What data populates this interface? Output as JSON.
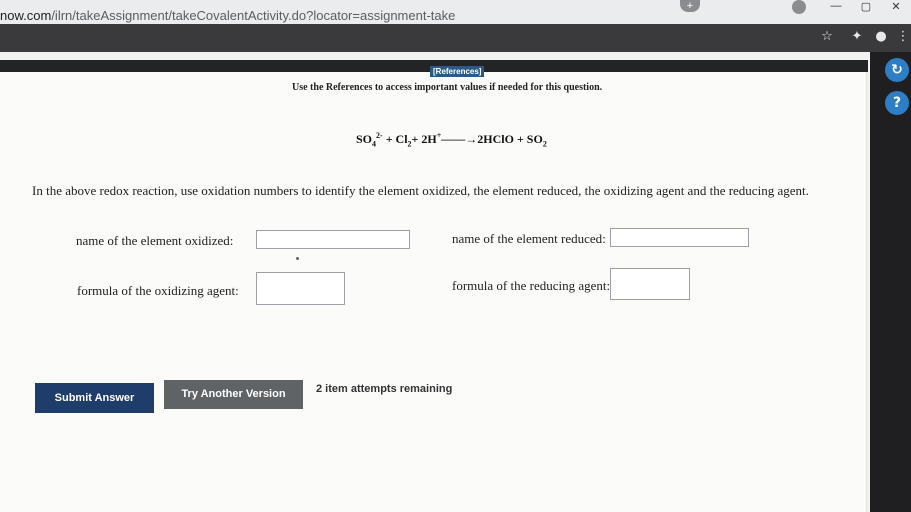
{
  "browser": {
    "url_domain": "now.com",
    "url_path": "/ilrn/takeAssignment/takeCovalentActivity.do?locator=assignment-take",
    "window_controls": [
      "—",
      "▢",
      "✕"
    ],
    "tab_plus": "+",
    "toolbar_icons": [
      "star-icon",
      "extension-icon",
      "profile-icon",
      "menu-icon"
    ]
  },
  "references_button": "[References]",
  "instruction": "Use the References to access important values if needed for this question.",
  "equation": {
    "r1": "SO",
    "r1_sub": "4",
    "r1_sup": "2-",
    "plus1": " + ",
    "r2": "Cl",
    "r2_sub": "2",
    "plus2": "+ ",
    "r3": "2H",
    "r3_sup": "+",
    "arrow": "——→",
    "p1": "2HClO",
    "plus3": " + ",
    "p2": "SO",
    "p2_sub": "2"
  },
  "question": "In the above redox reaction, use oxidation numbers to identify the element oxidized, the element reduced, the oxidizing agent and the reducing agent.",
  "fields": {
    "element_oxidized": {
      "label": "name of the element oxidized:",
      "value": ""
    },
    "element_reduced": {
      "label": "name of the element reduced:",
      "value": ""
    },
    "oxidizing_agent": {
      "label": "formula of the oxidizing agent:",
      "value": ""
    },
    "reducing_agent": {
      "label": "formula of the reducing agent:",
      "value": ""
    }
  },
  "buttons": {
    "submit": "Submit Answer",
    "try_another": "Try Another Version"
  },
  "attempts": "2 item attempts remaining",
  "side_buttons": {
    "refresh": "↻",
    "help": "?"
  },
  "colors": {
    "submit_bg": "#1f3d6b",
    "try_bg": "#5f6366",
    "references_bg": "#2b5a87",
    "side_accent": "#2d7ec4"
  }
}
